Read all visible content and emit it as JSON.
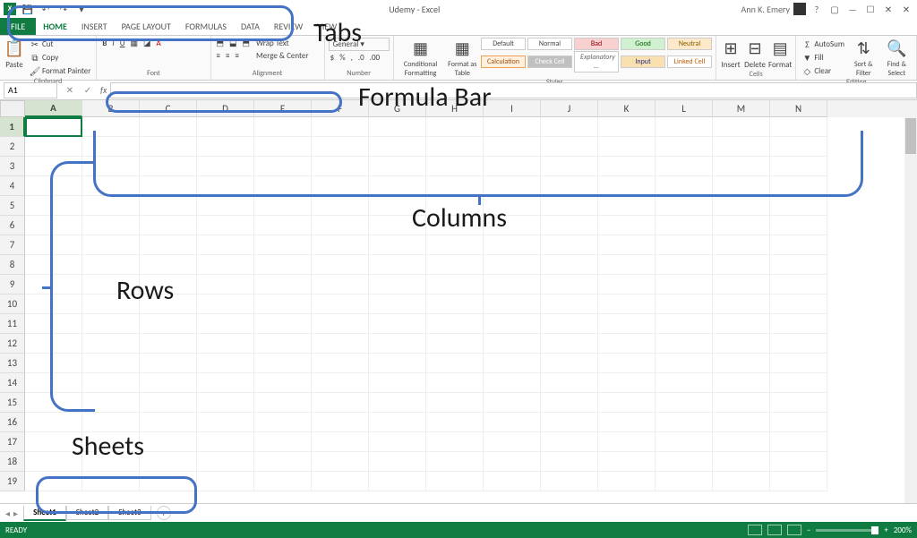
{
  "titlebar": {
    "app_glyph": "X",
    "doc_title": "Udemy - Excel",
    "user_name": "Ann K. Emery"
  },
  "qat": {
    "save": "💾",
    "undo": "↶",
    "redo": "↷",
    "more": "▾"
  },
  "window_controls": {
    "help": "?",
    "ribbon_opts": "▢",
    "min": "—",
    "max": "☐",
    "close": "✕",
    "close2": "✕"
  },
  "tabs": {
    "file": "FILE",
    "items": [
      "HOME",
      "INSERT",
      "PAGE LAYOUT",
      "FORMULAS",
      "DATA",
      "REVIEW",
      "VIEW"
    ],
    "active_index": 0
  },
  "ribbon": {
    "clipboard": {
      "label": "Clipboard",
      "paste": "Paste",
      "cut": "Cut",
      "copy": "Copy",
      "format_painter": "Format Painter"
    },
    "font": {
      "label": "Font"
    },
    "alignment": {
      "label": "Alignment",
      "wrap": "Wrap Text",
      "merge": "Merge & Center"
    },
    "number": {
      "label": "Number",
      "format": "General"
    },
    "styles": {
      "label": "Styles",
      "cond": "Conditional Formatting",
      "fmt_table": "Format as Table",
      "default": "Default",
      "normal": "Normal",
      "bad": "Bad",
      "good": "Good",
      "neutral": "Neutral",
      "calc": "Calculation",
      "check": "Check Cell",
      "expl": "Explanatory ...",
      "input": "Input",
      "linked": "Linked Cell"
    },
    "cells": {
      "label": "Cells",
      "insert": "Insert",
      "delete": "Delete",
      "format": "Format"
    },
    "editing": {
      "label": "Editing",
      "autosum": "AutoSum",
      "fill": "Fill",
      "clear": "Clear",
      "sort": "Sort & Filter",
      "find": "Find & Select"
    }
  },
  "formula_bar": {
    "cell_ref": "A1",
    "fx": "fx",
    "value": ""
  },
  "grid": {
    "columns": [
      "A",
      "B",
      "C",
      "D",
      "E",
      "F",
      "G",
      "H",
      "I",
      "J",
      "K",
      "L",
      "M",
      "N"
    ],
    "rows": [
      1,
      2,
      3,
      4,
      5,
      6,
      7,
      8,
      9,
      10,
      11,
      12,
      13,
      14,
      15,
      16,
      17,
      18,
      19
    ],
    "active_col": 0,
    "active_row": 0
  },
  "sheets": {
    "items": [
      "Sheet1",
      "Sheet2",
      "Sheet3"
    ],
    "active_index": 0,
    "add": "+",
    "nav_prev": "◂",
    "nav_next": "▸"
  },
  "statusbar": {
    "ready": "READY",
    "zoom": "200%",
    "zoom_minus": "−",
    "zoom_plus": "+"
  },
  "annotations": {
    "tabs": "Tabs",
    "formula_bar": "Formula Bar",
    "columns": "Columns",
    "rows": "Rows",
    "sheets": "Sheets"
  },
  "colors": {
    "accent": "#107c41",
    "annotation": "#4472c4"
  }
}
